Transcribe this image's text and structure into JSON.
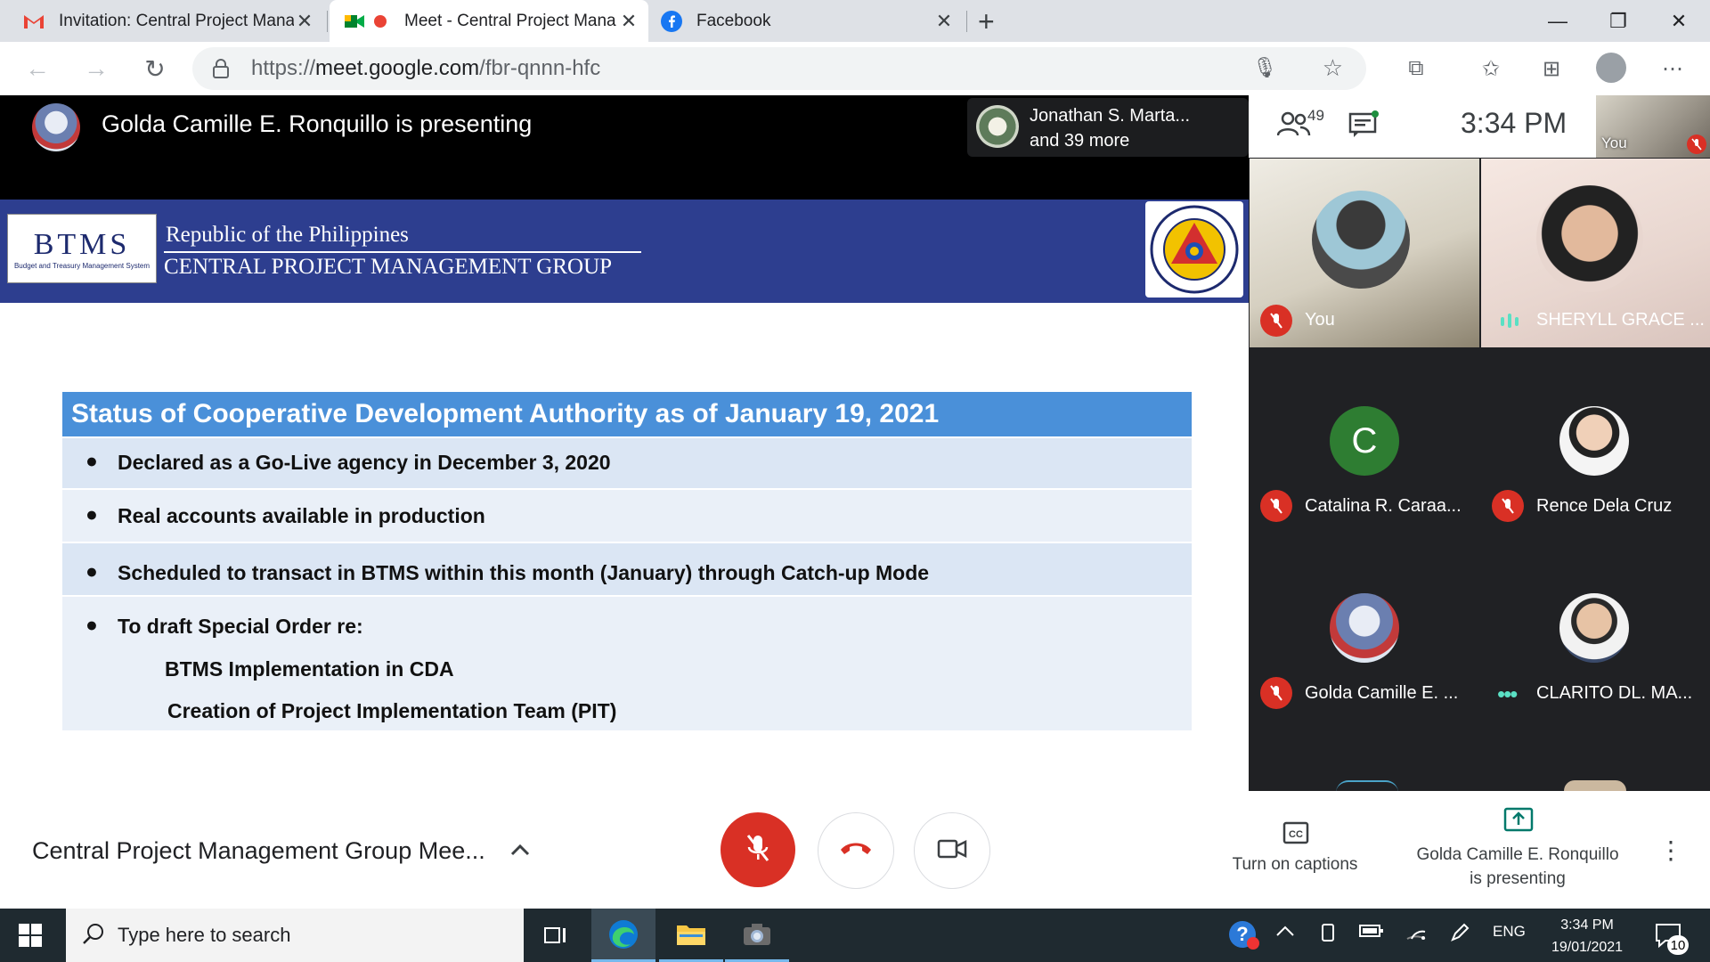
{
  "browser": {
    "tabs": [
      {
        "title": "Invitation: Central Project Manag",
        "icon": "gmail-icon"
      },
      {
        "title": "Meet - Central Project Mana",
        "icon": "meet-icon",
        "active": true
      },
      {
        "title": "Facebook",
        "icon": "facebook-icon"
      }
    ],
    "url_prefix": "https://",
    "url_host": "meet.google.com",
    "url_path": "/fbr-qnnn-hfc"
  },
  "meet": {
    "presenter_banner": "Golda Camille E. Ronquillo is presenting",
    "joined_line1": "Jonathan S. Marta...",
    "joined_line2": "and 39 more",
    "participant_count": "49",
    "clock": "3:34 PM",
    "self_thumb_label": "You",
    "meeting_name": "Central Project Management Group Mee...",
    "captions_label": "Turn on captions",
    "presenting_label_line1": "Golda Camille E. Ronquillo",
    "presenting_label_line2": "is presenting",
    "participants": [
      {
        "name": "You",
        "muted": true
      },
      {
        "name": "SHERYLL GRACE ...",
        "speaking": true
      },
      {
        "name": "Catalina R. Caraa...",
        "muted": true,
        "initial": "C"
      },
      {
        "name": "Rence Dela Cruz",
        "muted": true
      },
      {
        "name": "Golda Camille E. ...",
        "muted": true
      },
      {
        "name": "CLARITO DL. MA...",
        "more": true
      }
    ]
  },
  "slide": {
    "logo_text": "BTMS",
    "logo_subtext": "Budget and Treasury Management System",
    "line1": "Republic of the Philippines",
    "line2": "CENTRAL PROJECT MANAGEMENT GROUP",
    "heading": "Status of Cooperative Development Authority as of January 19, 2021",
    "bullets": [
      "Declared as a Go-Live agency in December 3, 2020",
      "Real accounts available in production",
      "Scheduled to transact in BTMS within this month (January) through Catch-up Mode",
      "To draft Special Order re:"
    ],
    "sub_items": [
      "BTMS Implementation in CDA",
      "Creation of Project Implementation Team (PIT)"
    ]
  },
  "taskbar": {
    "search_placeholder": "Type here to search",
    "lang": "ENG",
    "time": "3:34 PM",
    "date": "19/01/2021",
    "notif_count": "10"
  },
  "colors": {
    "meet_dark": "#202124",
    "banner_blue": "#2d3e8f",
    "heading_blue": "#4a90d9",
    "row_light": "#dbe6f4",
    "row_lighter": "#eaf0f8",
    "mute_red": "#d93025"
  }
}
